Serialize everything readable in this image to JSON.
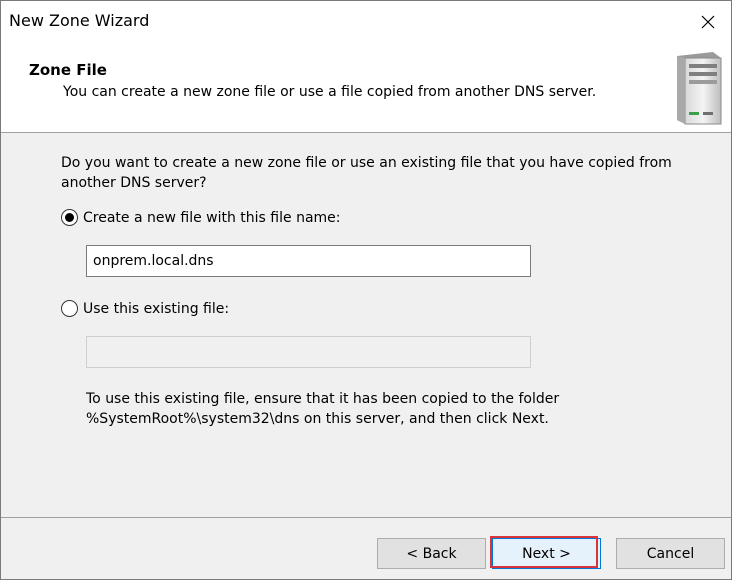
{
  "window": {
    "title": "New Zone Wizard"
  },
  "header": {
    "title": "Zone File",
    "subtitle": "You can create a new zone file or use a file copied from another DNS server."
  },
  "content": {
    "question": "Do you want to create a new zone file or use an existing file that you have copied from another DNS server?",
    "option_new": {
      "label": "Create a new file with this file name:",
      "checked": true,
      "value": "onprem.local.dns"
    },
    "option_existing": {
      "label": "Use this existing file:",
      "checked": false,
      "value": ""
    },
    "note_line1": "To use this existing file, ensure that it has been copied to the folder",
    "note_line2": "%SystemRoot%\\system32\\dns on this server, and then click Next."
  },
  "buttons": {
    "back": "< Back",
    "next": "Next >",
    "cancel": "Cancel"
  },
  "colors": {
    "highlight": "#d9343a",
    "accent": "#0078d7"
  }
}
